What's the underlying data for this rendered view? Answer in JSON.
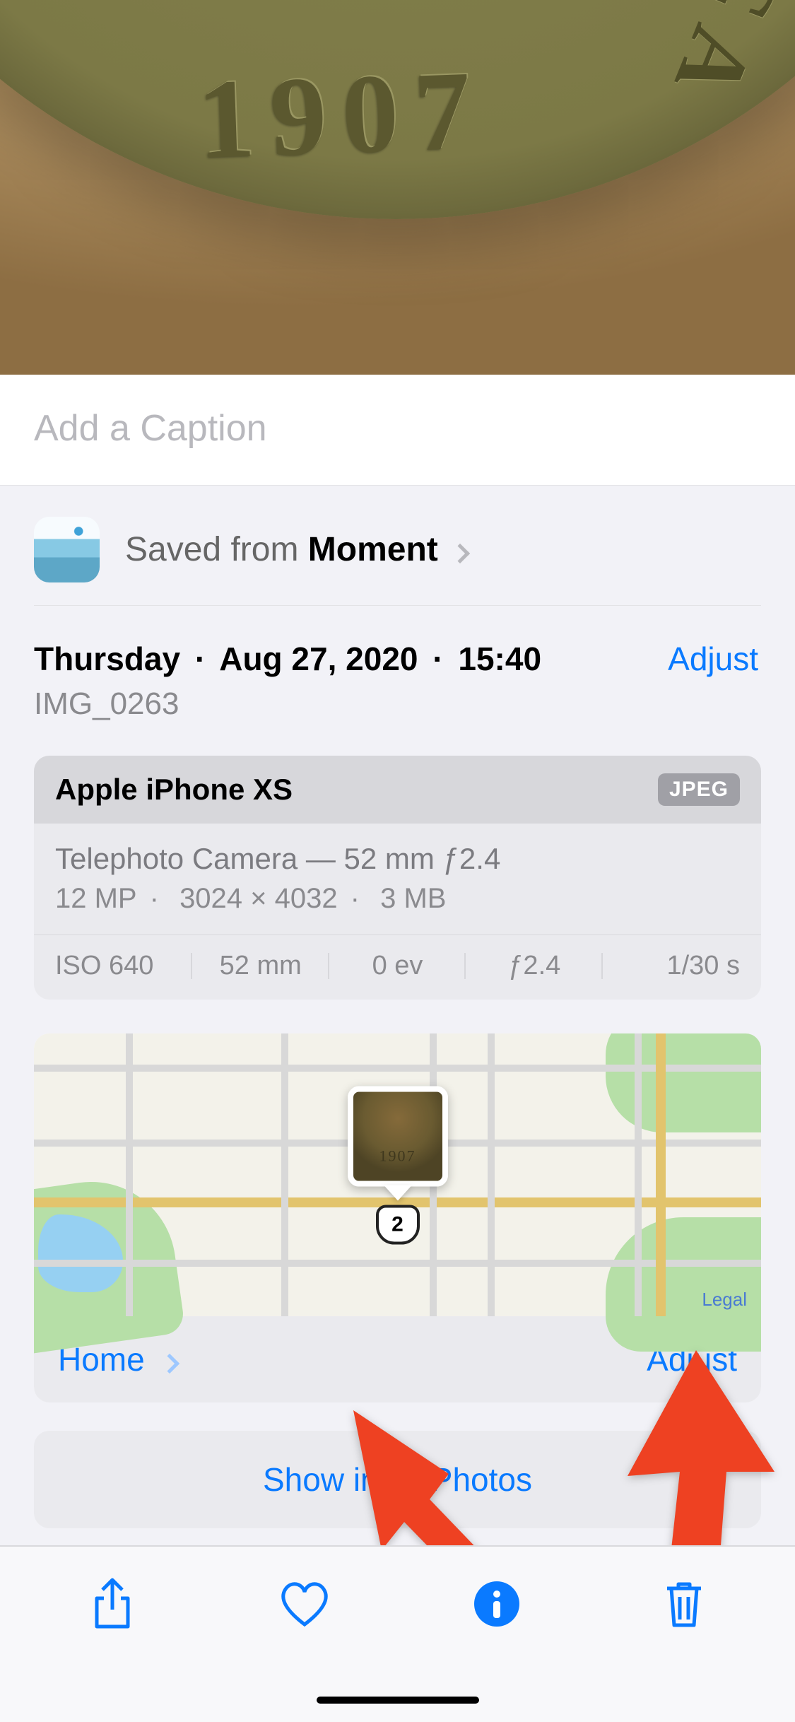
{
  "caption": {
    "placeholder": "Add a Caption",
    "value": ""
  },
  "source": {
    "prefix": "Saved from ",
    "app_name": "Moment"
  },
  "date": {
    "weekday": "Thursday",
    "date": "Aug 27, 2020",
    "time": "15:40",
    "adjust_label": "Adjust"
  },
  "filename": "IMG_0263",
  "camera": {
    "device": "Apple iPhone XS",
    "file_badge": "JPEG",
    "lens_line": "Telephoto Camera — 52 mm ƒ2.4",
    "megapixels": "12 MP",
    "dimensions": "3024 × 4032",
    "filesize": "3 MB",
    "stats": {
      "iso": "ISO 640",
      "focal": "52 mm",
      "ev": "0 ev",
      "aperture": "ƒ2.4",
      "shutter": "1/30 s"
    }
  },
  "map": {
    "location_name": "Home",
    "adjust_label": "Adjust",
    "highway_shield": "2",
    "credit": "Legal"
  },
  "allphotos_label": "Show in All Photos",
  "preview": {
    "year_text": "1907",
    "rim_text": "CA"
  },
  "toolbar": {
    "share": "Share",
    "favorite": "Favorite",
    "info": "Info",
    "delete": "Delete"
  }
}
